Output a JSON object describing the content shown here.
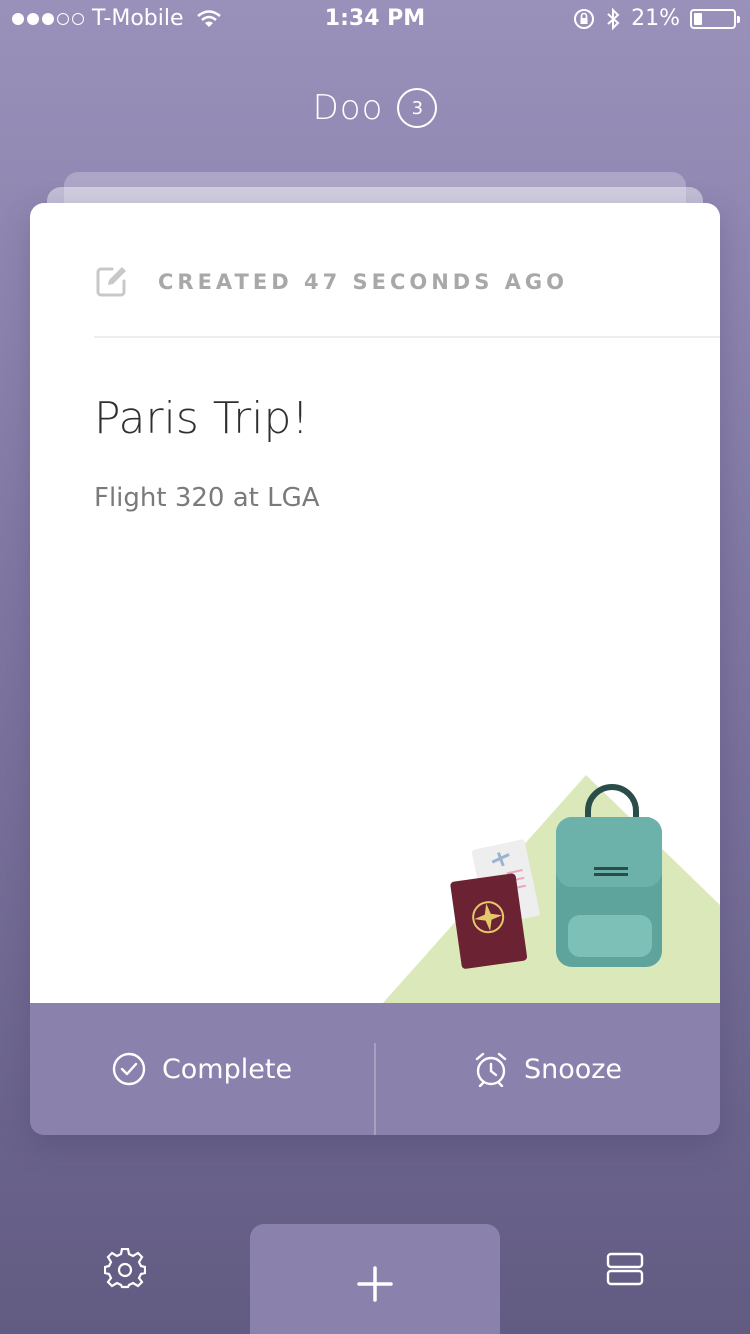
{
  "status_bar": {
    "signal_filled": 3,
    "signal_total": 5,
    "carrier": "T-Mobile",
    "time": "1:34 PM",
    "battery_label": "21%",
    "battery_level": 0.21
  },
  "header": {
    "title": "Doo",
    "count": "3"
  },
  "card": {
    "meta": "CREATED 47 SECONDS AGO",
    "title": "Paris Trip!",
    "subtitle": "Flight 320 at LGA",
    "meta_icon": "edit-icon",
    "illustration": "travel-illustration"
  },
  "actions": {
    "complete_label": "Complete",
    "snooze_label": "Snooze",
    "complete_icon": "check-circle-icon",
    "snooze_icon": "alarm-clock-icon"
  },
  "bottom_bar": {
    "settings_icon": "gear-icon",
    "add_icon": "plus-icon",
    "list_icon": "list-view-icon"
  },
  "colors": {
    "accent": "#8a82ac",
    "background_top": "#9a91bb",
    "background_bottom": "#625b82"
  }
}
